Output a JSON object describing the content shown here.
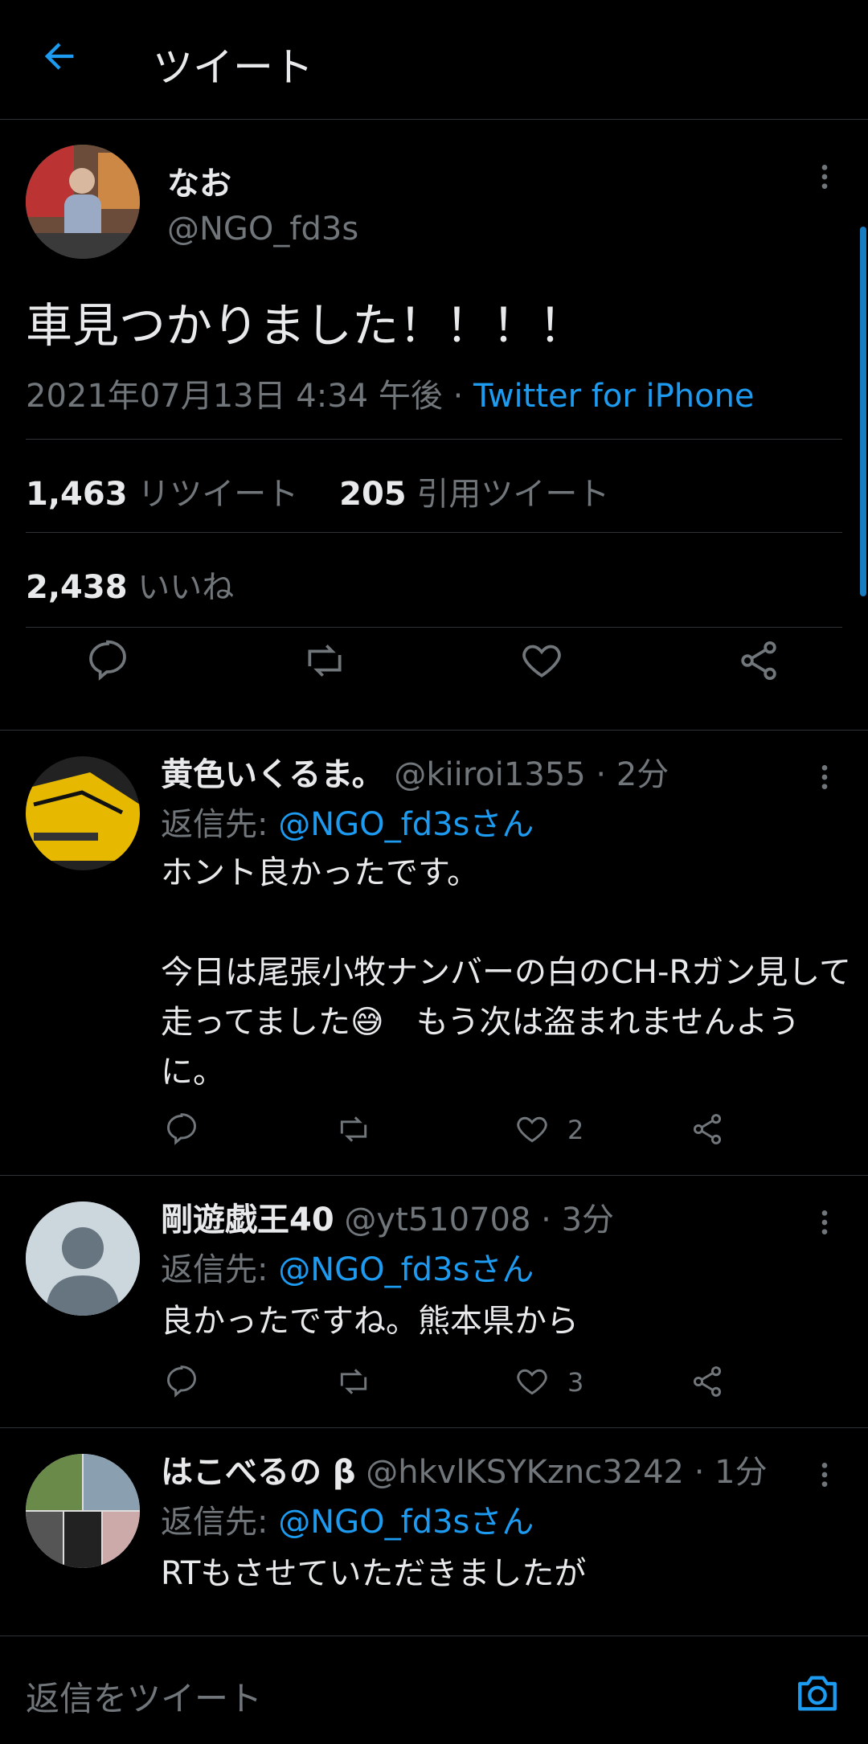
{
  "header": {
    "title": "ツイート"
  },
  "tweet": {
    "name": "なお",
    "handle": "@NGO_fd3s",
    "text": "車見つかりました！！！！",
    "timestamp": "2021年07月13日 4:34 午後",
    "source": "Twitter for iPhone",
    "retweets": "1,463",
    "retweets_label": "リツイート",
    "quotes": "205",
    "quotes_label": "引用ツイート",
    "likes": "2,438",
    "likes_label": "いいね"
  },
  "replies": [
    {
      "name": "黄色いくるま。",
      "handle": "@kiiroi1355",
      "time": "2分",
      "reply_to_label": "返信先:",
      "reply_to": "@NGO_fd3sさん",
      "text": "ホント良かったです。\n\n今日は尾張小牧ナンバーの白のCH-Rガン見して走ってました😅　もう次は盗まれませんように。",
      "likes": "2"
    },
    {
      "name": "剛遊戯王40",
      "handle": "@yt510708",
      "time": "3分",
      "reply_to_label": "返信先:",
      "reply_to": "@NGO_fd3sさん",
      "text": "良かったですね。熊本県から",
      "likes": "3"
    },
    {
      "name": "はこべるの β",
      "handle": "@hkvlKSYKznc3242",
      "time": "1分",
      "reply_to_label": "返信先:",
      "reply_to": "@NGO_fd3sさん",
      "text": "RTもさせていただきましたが"
    }
  ],
  "compose": {
    "placeholder": "返信をツイート"
  },
  "icons": {
    "back": "arrow-left-icon",
    "more": "more-vertical-icon",
    "reply": "reply-icon",
    "retweet": "retweet-icon",
    "like": "heart-icon",
    "share": "share-icon",
    "camera": "camera-icon"
  },
  "colors": {
    "background": "#000000",
    "accent": "#1d9bf0",
    "secondary": "#71767b"
  }
}
